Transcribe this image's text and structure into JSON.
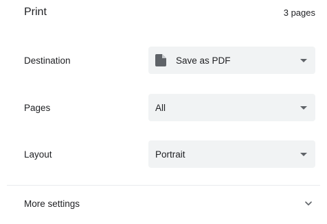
{
  "header": {
    "title": "Print",
    "page_count": "3 pages"
  },
  "destination": {
    "label": "Destination",
    "value": "Save as PDF",
    "icon": "file-icon"
  },
  "pages": {
    "label": "Pages",
    "value": "All"
  },
  "layout": {
    "label": "Layout",
    "value": "Portrait"
  },
  "more_settings": {
    "label": "More settings",
    "icon": "chevron-down-icon"
  },
  "colors": {
    "select_background": "#f1f3f4",
    "text": "#202124",
    "icon": "#5f6368",
    "divider": "#e8eaed"
  }
}
